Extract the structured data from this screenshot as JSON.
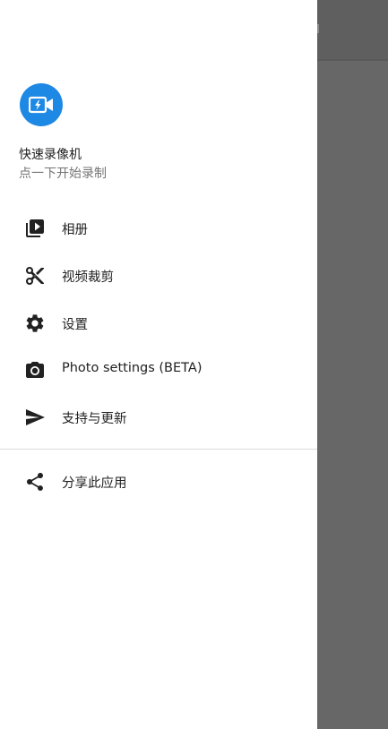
{
  "header": {
    "app_name": "快速录像机",
    "subtitle": "点一下开始录制",
    "logo_icon": "video-camera-bolt-icon",
    "logo_color": "#1e88e5"
  },
  "menu": {
    "items": [
      {
        "label": "相册",
        "icon": "video-library-icon"
      },
      {
        "label": "视频裁剪",
        "icon": "scissors-icon"
      },
      {
        "label": "设置",
        "icon": "gear-icon"
      },
      {
        "label": "Photo settings (BETA)",
        "icon": "camera-icon"
      },
      {
        "label": "支持与更新",
        "icon": "send-icon"
      }
    ],
    "secondary_items": [
      {
        "label": "分享此应用",
        "icon": "share-icon"
      }
    ]
  },
  "colors": {
    "scrim": "#676767",
    "icon": "#212121",
    "text_primary": "#212121",
    "text_secondary": "#757575"
  }
}
